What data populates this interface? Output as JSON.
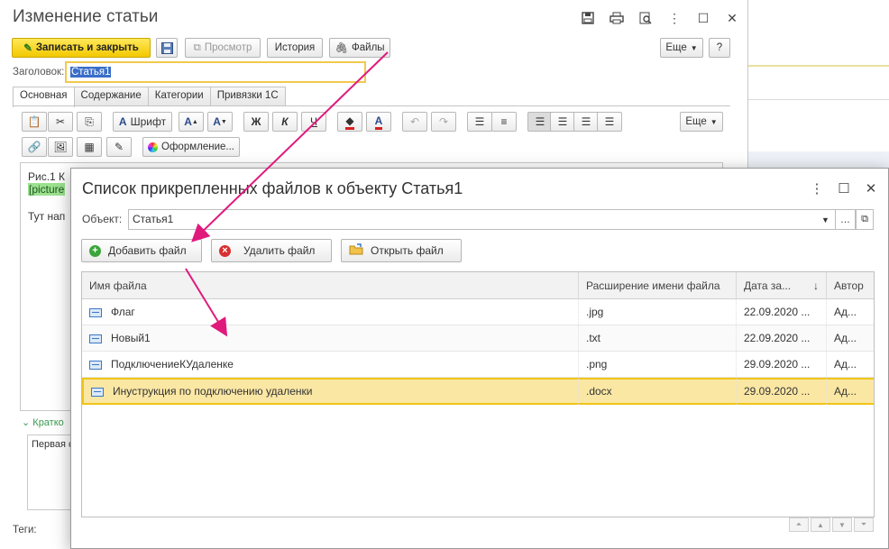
{
  "background_window": {
    "title": "Изменение статьи",
    "toolbar": {
      "save_close": "Записать и закрыть",
      "preview": "Просмотр",
      "history": "История",
      "files": "Файлы",
      "more": "Еще",
      "help": "?"
    },
    "title_label": "Заголовок:",
    "title_value": "Статья1",
    "tabs": [
      "Основная",
      "Содержание",
      "Категории",
      "Привязки 1С"
    ],
    "editor_toolbar": {
      "font": "Шрифт",
      "bold": "Ж",
      "italic": "К",
      "underline": "Ч",
      "more": "Еще",
      "design": "Оформление..."
    },
    "editor": {
      "line1": "Рис.1 К",
      "line2": "[picture",
      "line3": "Тут нап"
    },
    "short_toggle": "Кратко",
    "short_text": "Первая с",
    "tags_label": "Теги:"
  },
  "dialog": {
    "title": "Список прикрепленных файлов к объекту Статья1",
    "object_label": "Объект:",
    "object_value": "Статья1",
    "buttons": {
      "add": "Добавить файл",
      "delete": "Удалить файл",
      "open": "Открыть файл"
    },
    "columns": [
      "Имя файла",
      "Расширение имени файла",
      "Дата за...",
      "Автор"
    ],
    "rows": [
      {
        "name": "Флаг",
        "ext": ".jpg",
        "date": "22.09.2020 ...",
        "author": "Ад..."
      },
      {
        "name": "Новый1",
        "ext": ".txt",
        "date": "22.09.2020 ...",
        "author": "Ад..."
      },
      {
        "name": "ПодключениеКУдаленке",
        "ext": ".png",
        "date": "29.09.2020 ...",
        "author": "Ад..."
      },
      {
        "name": "Инуструкция по подключению удаленки",
        "ext": ".docx",
        "date": "29.09.2020 ...",
        "author": "Ад..."
      }
    ],
    "sort_arrow": "↓"
  },
  "colors": {
    "accent_yellow": "#f2c800",
    "selection_row": "#fbe7a4",
    "arrow": "#e0197d"
  }
}
